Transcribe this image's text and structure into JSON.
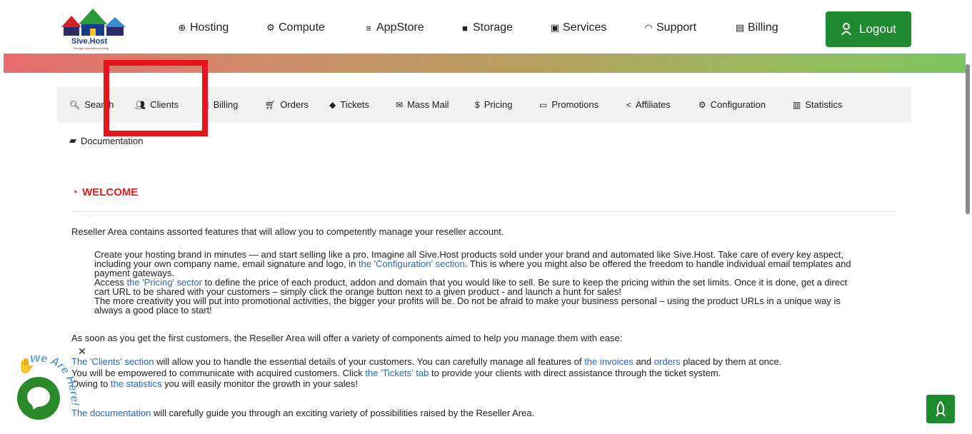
{
  "header": {
    "logo_text": "Sive.Host",
    "logo_tagline": "The light and best in hosting",
    "nav": [
      {
        "label": "Hosting",
        "icon": "globe-icon"
      },
      {
        "label": "Compute",
        "icon": "gear-icon"
      },
      {
        "label": "AppStore",
        "icon": "database-icon"
      },
      {
        "label": "Storage",
        "icon": "box-icon"
      },
      {
        "label": "Services",
        "icon": "gift-icon"
      },
      {
        "label": "Support",
        "icon": "headset-icon"
      },
      {
        "label": "Billing",
        "icon": "receipt-icon"
      }
    ],
    "logout_label": "Logout"
  },
  "subnav": {
    "items": [
      {
        "label": "Search",
        "icon": "search-icon"
      },
      {
        "label": "Clients",
        "icon": "users-icon"
      },
      {
        "label": "Billing",
        "icon": "file-icon"
      },
      {
        "label": "Orders",
        "icon": "cart-icon"
      },
      {
        "label": "Tickets",
        "icon": "ticket-icon"
      },
      {
        "label": "Mass Mail",
        "icon": "envelope-icon"
      },
      {
        "label": "Pricing",
        "icon": "dollar-icon"
      },
      {
        "label": "Promotions",
        "icon": "money-icon"
      },
      {
        "label": "Affiliates",
        "icon": "share-icon"
      },
      {
        "label": "Configuration",
        "icon": "cogs-icon"
      },
      {
        "label": "Statistics",
        "icon": "bar-chart-icon"
      }
    ],
    "documentation": "Documentation",
    "highlight_color": "#e4161c"
  },
  "main": {
    "welcome_title": "WELCOME",
    "intro": "Reseller Area contains assorted features that will allow you to competently manage your reseller account.",
    "b1_l1": "Create your hosting brand in minutes — and start selling like a pro. Imagine all Sive.Host products sold under your brand and automated like Sive.Host. Take care of every key aspect,",
    "b1_l2a": "including your own company name, email signature and logo, in ",
    "b1_l2_link": "the 'Configuration' section",
    "b1_l2b": ". This is where you might also be offered the freedom to handle individual email templates and",
    "b1_l3": "payment gateways.",
    "b2_l1a": "Access ",
    "b2_l1_link": "the 'Pricing' sector",
    "b2_l1b": " to define the price of each product, addon and domain that you would like to sell. Be sure to keep the pricing within the set limits. Once it is done, get a direct",
    "b2_l2": "cart URL to be shared with your customers – simply click the orange button next to a given product - and launch a hunt for sales!",
    "b3_l1": "The more creativity you will put into promotional activities, the bigger your profits will be. Do not be afraid to make your business personal – using the product URLs in a unique way is",
    "b3_l2": "always a good place to start!",
    "second_intro": "As soon as you get the first customers, the Reseller Area will offer a variety of components aimed to help you manage them with ease:",
    "c1_link": "The 'Clients' section",
    "c1_a": " will allow you to handle the essential details of your customers. You can carefully manage all features of ",
    "c1_link2": "the invoices",
    "c1_b": " and ",
    "c1_link3": "orders",
    "c1_c": " placed by them at once.",
    "c2_a": "You will be empowered to communicate with acquired customers. Click ",
    "c2_link": "the 'Tickets' tab",
    "c2_b": " to provide your clients with direct assistance through the ticket system.",
    "c3_a": "Owing to ",
    "c3_link": "the statistics",
    "c3_b": " you will easily monitor the growth in your sales!",
    "d_link": "The documentation",
    "d_a": " will carefully guide you through an exciting variety of possibilities raised by the Reseller Area."
  },
  "chat": {
    "close": "✕",
    "we_are_here": "We Are Here!"
  },
  "colors": {
    "accent_green": "#1f8a2f",
    "welcome_red": "#d32020",
    "link_blue": "#2a6ab8"
  }
}
